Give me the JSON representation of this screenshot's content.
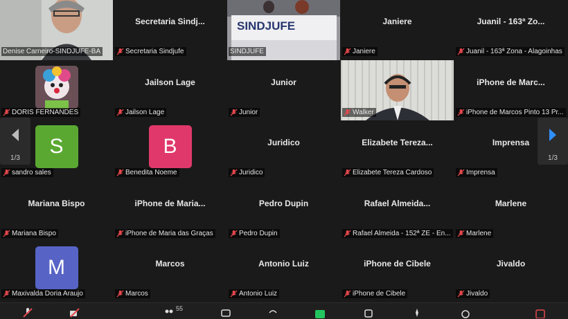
{
  "pagination": {
    "prev_page": "1/3",
    "next_page": "1/3"
  },
  "participants": [
    {
      "center": "",
      "label": "Denise Carneiro-SINDJUFE-BA",
      "muted": false,
      "avatar": null,
      "video": "denise",
      "active": true
    },
    {
      "center": "Secretaria  Sindj...",
      "label": "Secretaria Sindjufe",
      "muted": true
    },
    {
      "center": "",
      "label": "SINDJUFE",
      "muted": false,
      "video": "sindjufe",
      "banner": "SINDJUFE"
    },
    {
      "center": "Janiere",
      "label": "Janiere",
      "muted": true
    },
    {
      "center": "Juanil - 163ª Zo...",
      "label": "Juanil - 163ª Zona - Alagoinhas",
      "muted": true
    },
    {
      "center": "",
      "label": "DORIS FERNANDES",
      "muted": true,
      "photo": "doris"
    },
    {
      "center": "Jailson Lage",
      "label": "Jailson Lage",
      "muted": true
    },
    {
      "center": "Junior",
      "label": "Junior",
      "muted": true
    },
    {
      "center": "",
      "label": "Walker",
      "muted": true,
      "video": "walker"
    },
    {
      "center": "iPhone  de  Marc...",
      "label": "iPhone de Marcos Pinto 13 Pr...",
      "muted": true
    },
    {
      "center": "",
      "label": "sandro sales",
      "muted": true,
      "avatar": "S",
      "avatar_color": "#5aa832"
    },
    {
      "center": "",
      "label": "Benedita Noeme",
      "muted": true,
      "avatar": "B",
      "avatar_color": "#e0386a"
    },
    {
      "center": "Juridico",
      "label": "Juridico",
      "muted": true
    },
    {
      "center": "Elizabete  Tereza...",
      "label": "Elizabete Tereza Cardoso",
      "muted": true
    },
    {
      "center": "Imprensa",
      "label": "Imprensa",
      "muted": true
    },
    {
      "center": "Mariana Bispo",
      "label": "Mariana Bispo",
      "muted": true
    },
    {
      "center": "iPhone  de  Maria...",
      "label": "iPhone de Maria das Graças",
      "muted": true
    },
    {
      "center": "Pedro Dupin",
      "label": "Pedro Dupin",
      "muted": true
    },
    {
      "center": "Rafael  Almeida...",
      "label": "Rafael Almeida - 152ª ZE - En...",
      "muted": true
    },
    {
      "center": "Marlene",
      "label": "Marlene",
      "muted": true
    },
    {
      "center": "",
      "label": "Maxivalda Doria Araujo",
      "muted": true,
      "avatar": "M",
      "avatar_color": "#5764c6"
    },
    {
      "center": "Marcos",
      "label": "Marcos",
      "muted": true
    },
    {
      "center": "Antonio Luiz",
      "label": "Antonio Luiz",
      "muted": true
    },
    {
      "center": "iPhone de Cibele",
      "label": "iPhone de Cibele",
      "muted": true
    },
    {
      "center": "Jivaldo",
      "label": "Jivaldo",
      "muted": true
    }
  ],
  "toolbar": {
    "participants_count": "55"
  },
  "colors": {
    "background": "#1a1a1a",
    "active_speaker": "#22c55e",
    "muted_mic": "#e5484d",
    "next_arrow": "#2f8fff"
  }
}
